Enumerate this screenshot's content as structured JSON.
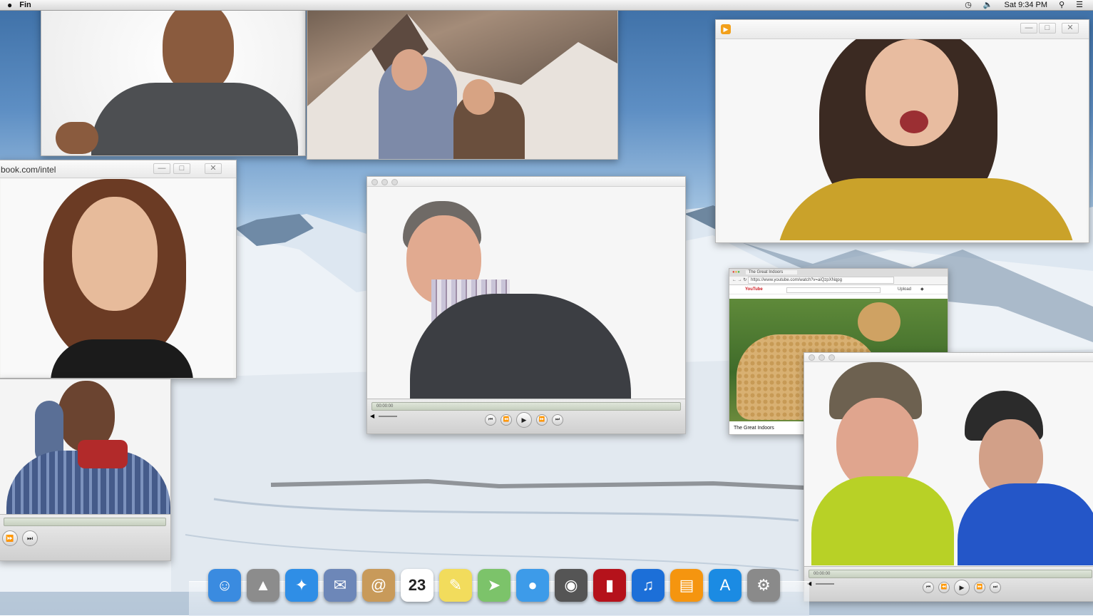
{
  "menubar": {
    "apple": "",
    "app_menu": "Fin",
    "clock": "Sat 9:34 PM",
    "icons": [
      "time-machine-icon",
      "volume-icon",
      "spotlight-icon",
      "notification-icon"
    ]
  },
  "windows": {
    "browser_left": {
      "url_fragment": "book.com/intel"
    },
    "youtube": {
      "tab_title": "The Great Indoors",
      "address": "https://www.youtube.com/watch?v=aiQzpXNqpg",
      "logo": "YouTube",
      "upload_label": "Upload",
      "video_title": "The Great Indoors"
    },
    "player_center": {
      "timecode": "00:00:00"
    },
    "player_right": {
      "timecode": "00:00:00"
    }
  },
  "dock": {
    "items": [
      {
        "name": "finder",
        "icon": "finder-icon",
        "color": "#3a8be0"
      },
      {
        "name": "launchpad",
        "icon": "rocket-icon",
        "color": "#8c8c8c"
      },
      {
        "name": "safari",
        "icon": "compass-icon",
        "color": "#2f8ee6"
      },
      {
        "name": "mail",
        "icon": "stamp-icon",
        "color": "#6d87b8"
      },
      {
        "name": "contacts",
        "icon": "address-book-icon",
        "color": "#c89a5a"
      },
      {
        "name": "calendar",
        "icon": "calendar-icon",
        "color": "#ffffff",
        "text": "23"
      },
      {
        "name": "notes",
        "icon": "notes-icon",
        "color": "#f2dc5c"
      },
      {
        "name": "maps",
        "icon": "map-icon",
        "color": "#7cc36a"
      },
      {
        "name": "messages",
        "icon": "speech-bubbles-icon",
        "color": "#3d9be9"
      },
      {
        "name": "facetime",
        "icon": "camera-icon",
        "color": "#555555"
      },
      {
        "name": "photo-booth",
        "icon": "curtain-icon",
        "color": "#b5121b"
      },
      {
        "name": "itunes",
        "icon": "music-note-icon",
        "color": "#1c6fd8"
      },
      {
        "name": "ibooks",
        "icon": "book-icon",
        "color": "#f5950f"
      },
      {
        "name": "app-store",
        "icon": "app-store-icon",
        "color": "#1b8be3"
      },
      {
        "name": "system-preferences",
        "icon": "gear-icon",
        "color": "#8a8a8a"
      }
    ]
  }
}
